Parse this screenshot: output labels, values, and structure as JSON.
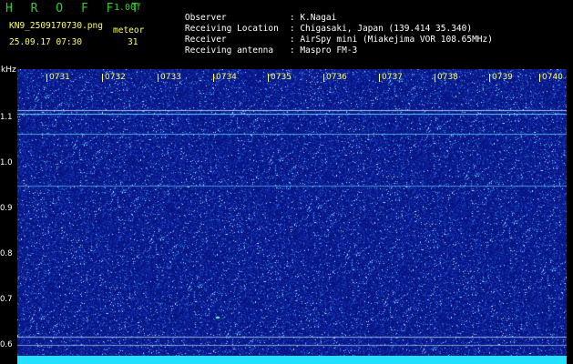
{
  "header": {
    "app_title": "H R O F F T",
    "version": "1.00f",
    "filename": "KN9_2509170730.png",
    "datetime": "25.09.17 07:30",
    "meteor_label": "meteor",
    "meteor_count": "31"
  },
  "info": [
    {
      "key": "Observer",
      "value": ": K.Nagai"
    },
    {
      "key": "Receiving Location",
      "value": ": Chigasaki, Japan (139.414 35.340)"
    },
    {
      "key": "Receiver",
      "value": ": AirSpy mini (Miakejima VOR 108.65MHz)"
    },
    {
      "key": "Receiving antenna",
      "value": ": Maspro FM-3"
    }
  ],
  "axis": {
    "unit": "kHz",
    "freq_labels": [
      "1.1",
      "1.0",
      "0.9",
      "0.8",
      "0.7",
      "0.6"
    ],
    "time_labels": [
      "0731",
      "0732",
      "0733",
      "0734",
      "0735",
      "0736",
      "0737",
      "0738",
      "0739",
      "0740"
    ]
  },
  "colors": {
    "title_green": "#33cc33",
    "label_yellow": "#ffff66",
    "background_blue": "#0a1a9a",
    "bottom_bar": "#22e0ff"
  }
}
